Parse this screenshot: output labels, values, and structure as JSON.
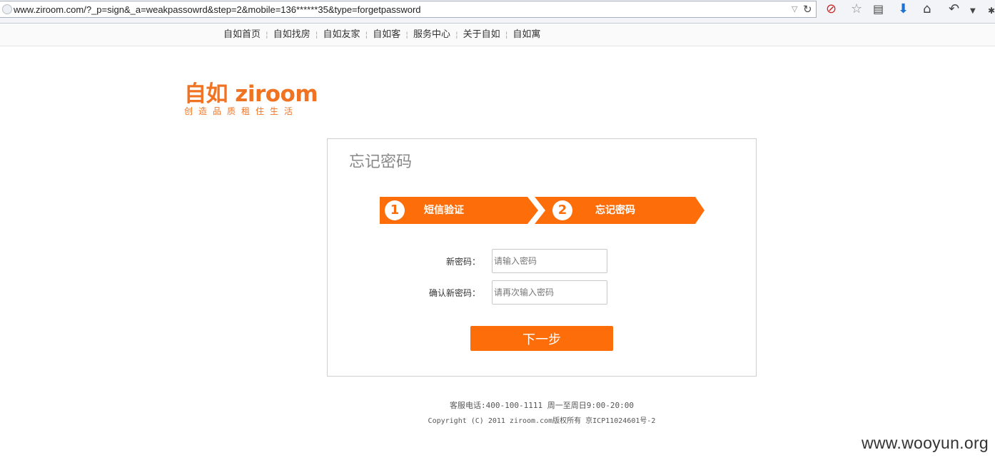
{
  "browser": {
    "url": "www.ziroom.com/?_p=sign&_a=weakpassowrd&step=2&mobile=136******35&type=forgetpassword"
  },
  "topnav": {
    "items": [
      "自如首页",
      "自如找房",
      "自如友家",
      "自如客",
      "服务中心",
      "关于自如",
      "自如寓"
    ]
  },
  "logo": {
    "main": "自如 ziroom",
    "sub": "创造品质租住生活",
    "color": "#f07323"
  },
  "panel": {
    "title": "忘记密码",
    "steps": [
      {
        "num": "1",
        "label": "短信验证"
      },
      {
        "num": "2",
        "label": "忘记密码"
      }
    ],
    "new_password": {
      "label": "新密码：",
      "placeholder": "请输入密码"
    },
    "confirm_password": {
      "label": "确认新密码：",
      "placeholder": "请再次输入密码"
    },
    "next_button": "下一步",
    "accent_color": "#fd6e0a"
  },
  "footer": {
    "line1": "客服电话:400-100-1111 周一至周日9:00-20:00",
    "line2": "Copyright (C) 2011 ziroom.com版权所有 京ICP11024601号-2"
  },
  "watermark": "www.wooyun.org"
}
